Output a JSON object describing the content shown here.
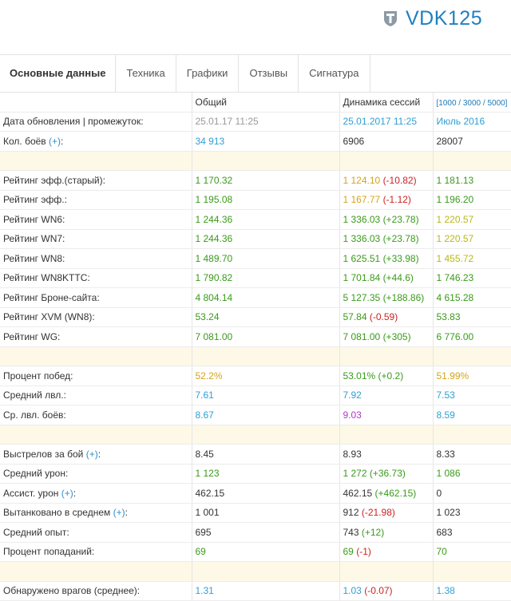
{
  "brand": {
    "name": "VDK125",
    "icon": "wot-helmet-icon"
  },
  "tabs": [
    "Основные данные",
    "Техника",
    "Графики",
    "Отзывы",
    "Сигнатура"
  ],
  "header": {
    "col_general": "Общий",
    "col_dynamics": "Динамика сессий",
    "col_range": "[1000 / 3000 / 5000]"
  },
  "rows": [
    {
      "label": "Дата обновления | промежуток:",
      "plus": "",
      "a": "25.01.17 11:25",
      "ac": "gray",
      "b": "25.01.2017 11:25",
      "bc": "blue",
      "bd": "",
      "bdc": "",
      "c": "Июль 2016",
      "cc": "blue"
    },
    {
      "label": "Кол. боёв",
      "plus": "(+)",
      "suffix": ":",
      "a": "34 913",
      "ac": "blue",
      "b": "6906",
      "bc": "dark",
      "bd": "",
      "bdc": "",
      "c": "28007",
      "cc": "dark"
    },
    {
      "sep": true
    },
    {
      "label": "Рейтинг эфф.(старый):",
      "plus": "",
      "a": "1 170.32",
      "ac": "green",
      "b": "1 124.10",
      "bc": "orange",
      "bd": "(-10.82)",
      "bdc": "red",
      "c": "1 181.13",
      "cc": "green"
    },
    {
      "label": "Рейтинг эфф.:",
      "plus": "",
      "a": "1 195.08",
      "ac": "green",
      "b": "1 167.77",
      "bc": "orange",
      "bd": "(-1.12)",
      "bdc": "red",
      "c": "1 196.20",
      "cc": "green"
    },
    {
      "label": "Рейтинг WN6:",
      "plus": "",
      "a": "1 244.36",
      "ac": "green",
      "b": "1 336.03",
      "bc": "green",
      "bd": "(+23.78)",
      "bdc": "green",
      "c": "1 220.57",
      "cc": "yellow"
    },
    {
      "label": "Рейтинг WN7:",
      "plus": "",
      "a": "1 244.36",
      "ac": "green",
      "b": "1 336.03",
      "bc": "green",
      "bd": "(+23.78)",
      "bdc": "green",
      "c": "1 220.57",
      "cc": "yellow"
    },
    {
      "label": "Рейтинг WN8:",
      "plus": "",
      "a": "1 489.70",
      "ac": "green",
      "b": "1 625.51",
      "bc": "green",
      "bd": "(+33.98)",
      "bdc": "green",
      "c": "1 455.72",
      "cc": "yellow"
    },
    {
      "label": "Рейтинг WN8KTTC:",
      "plus": "",
      "a": "1 790.82",
      "ac": "green",
      "b": "1 701.84",
      "bc": "green",
      "bd": "(+44.6)",
      "bdc": "green",
      "c": "1 746.23",
      "cc": "green"
    },
    {
      "label": "Рейтинг Броне-сайта:",
      "plus": "",
      "a": "4 804.14",
      "ac": "green",
      "b": "5 127.35",
      "bc": "green",
      "bd": "(+188.86)",
      "bdc": "green",
      "c": "4 615.28",
      "cc": "green"
    },
    {
      "label": "Рейтинг XVM (WN8):",
      "plus": "",
      "a": "53.24",
      "ac": "green",
      "b": "57.84",
      "bc": "green",
      "bd": "(-0.59)",
      "bdc": "red",
      "c": "53.83",
      "cc": "green"
    },
    {
      "label": "Рейтинг WG:",
      "plus": "",
      "a": "7 081.00",
      "ac": "green",
      "b": "7 081.00",
      "bc": "green",
      "bd": "(+305)",
      "bdc": "green",
      "c": "6 776.00",
      "cc": "green"
    },
    {
      "sep": true
    },
    {
      "label": "Процент побед:",
      "plus": "",
      "a": "52.2%",
      "ac": "orange",
      "b": "53.01%",
      "bc": "green",
      "bd": "(+0.2)",
      "bdc": "green",
      "c": "51.99%",
      "cc": "orange"
    },
    {
      "label": "Средний лвл.:",
      "plus": "",
      "a": "7.61",
      "ac": "blue",
      "b": "7.92",
      "bc": "blue",
      "bd": "",
      "bdc": "",
      "c": "7.53",
      "cc": "blue"
    },
    {
      "label": "Ср. лвл. боёв:",
      "plus": "",
      "a": "8.67",
      "ac": "blue",
      "b": "9.03",
      "bc": "purple",
      "bd": "",
      "bdc": "",
      "c": "8.59",
      "cc": "blue"
    },
    {
      "sep": true
    },
    {
      "label": "Выстрелов за бой",
      "plus": "(+)",
      "suffix": ":",
      "a": "8.45",
      "ac": "dark",
      "b": "8.93",
      "bc": "dark",
      "bd": "",
      "bdc": "",
      "c": "8.33",
      "cc": "dark"
    },
    {
      "label": "Средний урон:",
      "plus": "",
      "a": "1 123",
      "ac": "green",
      "b": "1 272",
      "bc": "green",
      "bd": "(+36.73)",
      "bdc": "green",
      "c": "1 086",
      "cc": "green"
    },
    {
      "label": "Ассист. урон",
      "plus": "(+)",
      "suffix": ":",
      "a": "462.15",
      "ac": "dark",
      "b": "462.15",
      "bc": "dark",
      "bd": "(+462.15)",
      "bdc": "green",
      "c": "0",
      "cc": "dark"
    },
    {
      "label": "Вытанковано в среднем",
      "plus": "(+)",
      "suffix": ":",
      "a": "1 001",
      "ac": "dark",
      "b": "912",
      "bc": "dark",
      "bd": "(-21.98)",
      "bdc": "red",
      "c": "1 023",
      "cc": "dark"
    },
    {
      "label": "Средний опыт:",
      "plus": "",
      "a": "695",
      "ac": "dark",
      "b": "743",
      "bc": "dark",
      "bd": "(+12)",
      "bdc": "green",
      "c": "683",
      "cc": "dark"
    },
    {
      "label": "Процент попаданий:",
      "plus": "",
      "a": "69",
      "ac": "green",
      "b": "69",
      "bc": "green",
      "bd": "(-1)",
      "bdc": "red",
      "c": "70",
      "cc": "green"
    },
    {
      "sep": true
    },
    {
      "label": "Обнаружено врагов (среднее):",
      "plus": "",
      "a": "1.31",
      "ac": "blue",
      "b": "1.03",
      "bc": "blue",
      "bd": "(-0.07)",
      "bdc": "red",
      "c": "1.38",
      "cc": "blue"
    }
  ]
}
